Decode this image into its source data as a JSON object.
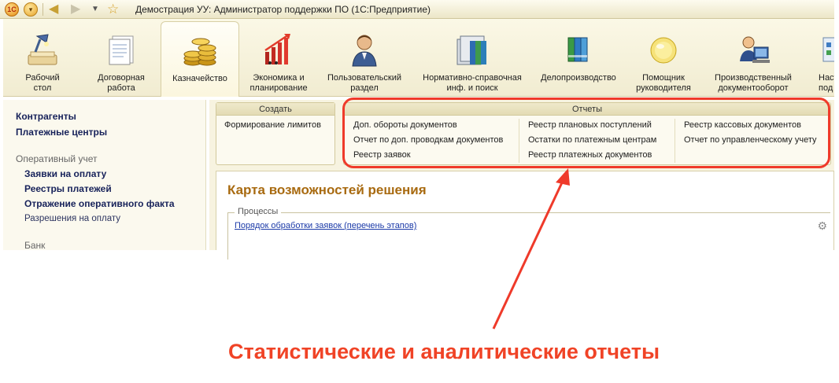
{
  "window": {
    "title": "Демострация УУ: Администратор поддержки ПО  (1С:Предприятие)",
    "logo_text": "1C"
  },
  "sections": [
    {
      "label_l1": "Рабочий",
      "label_l2": "стол",
      "icon": "desk-lamp-icon"
    },
    {
      "label_l1": "Договорная",
      "label_l2": "работа",
      "icon": "documents-icon"
    },
    {
      "label_l1": "Казначейство",
      "label_l2": "",
      "icon": "coins-icon"
    },
    {
      "label_l1": "Экономика и",
      "label_l2": "планирование",
      "icon": "growth-chart-icon"
    },
    {
      "label_l1": "Пользовательский",
      "label_l2": "раздел",
      "icon": "user-icon"
    },
    {
      "label_l1": "Нормативно-справочная",
      "label_l2": "инф. и поиск",
      "icon": "binders-icon"
    },
    {
      "label_l1": "Делопроизводство",
      "label_l2": "",
      "icon": "folders-icon"
    },
    {
      "label_l1": "Помощник",
      "label_l2": "руководителя",
      "icon": "assistant-icon"
    },
    {
      "label_l1": "Производственный",
      "label_l2": "документооборот",
      "icon": "workstation-icon"
    },
    {
      "label_l1": "Наст",
      "label_l2": "под",
      "icon": "settings-icon"
    }
  ],
  "nav": {
    "top": [
      "Контрагенты",
      "Платежные центры"
    ],
    "group_operational": "Оперативный учет",
    "operational": [
      "Заявки на оплату",
      "Реестры платежей",
      "Отражение оперативного факта"
    ],
    "operational_light": "Разрешения на оплату",
    "group_bank": "Банк"
  },
  "create": {
    "title": "Создать",
    "commands": [
      "Формирование лимитов"
    ]
  },
  "reports": {
    "title": "Отчеты",
    "col1": [
      "Доп. обороты документов",
      "Отчет по доп. проводкам документов",
      "Реестр заявок"
    ],
    "col2": [
      "Реестр плановых поступлений",
      "Остатки по платежным центрам",
      "Реестр платежных документов"
    ],
    "col3": [
      "Реестр кассовых документов",
      "Отчет по управленческому учету"
    ]
  },
  "map": {
    "title": "Карта возможностей решения",
    "processes_label": "Процессы",
    "process_link": "Порядок обработки заявок (перечень этапов)"
  },
  "annotation": {
    "caption": "Статистические и аналитические отчеты",
    "color": "#f04326"
  }
}
